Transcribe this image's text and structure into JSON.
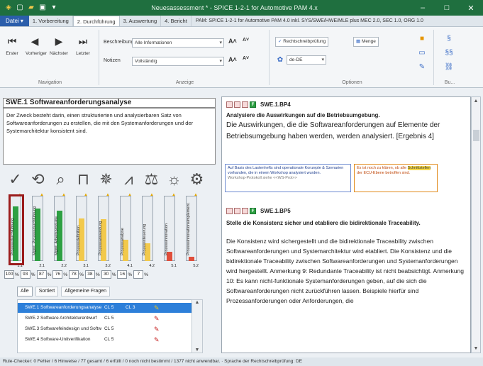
{
  "window": {
    "title": "Neuesassessment * - SPICE 1-2-1 for Automotive PAM 4.x",
    "minimize": "–",
    "maximize": "□",
    "close": "✕"
  },
  "tabs": {
    "file": "Datei ▾",
    "items": [
      "1. Vorbereitung",
      "2. Durchführung",
      "3. Auswertung",
      "4. Bericht"
    ],
    "active_index": 1,
    "info": "PAM: SPICE 1-2-1 for Automotive PAM 4.0 inkl. SYS/SWE/HWE/MLE plus MEC 2.0, SEC 1.0, ORG 1.0"
  },
  "ribbon": {
    "nav": {
      "first": "Erster",
      "prev": "Vorheriger",
      "next": "Nächster",
      "last": "Letzter",
      "group_label": "Navigation"
    },
    "display": {
      "desc_label": "Beschreibung",
      "desc_value": "Alle Informationen",
      "notes_label": "Notizen",
      "notes_value": "Vollständig",
      "group_label": "Anzeige"
    },
    "options": {
      "spellcheck": "Rechtschreibprüfung",
      "amount": "Menge",
      "language": "de-DE",
      "group_label": "Optionen"
    },
    "more_label": "Bu..."
  },
  "process": {
    "title": "SWE.1 Softwareanforderungsanalyse",
    "description": "Der Zweck besteht darin, einen strukturierten und analysierbaren Satz von Softwareanforderungen zu erstellen, die mit den Systemanforderungen und der Systemarchitektur konsistent sind."
  },
  "attribute_icons": [
    "check-icon",
    "process-icon",
    "search-icon",
    "book-icon",
    "gear-icon",
    "chart-icon",
    "balance-icon",
    "bulb-icon",
    "cogs-icon"
  ],
  "bars": [
    {
      "label": "Prozessdurchführung",
      "level": "1.1",
      "fill": 0.92,
      "color": "#2ea043"
    },
    {
      "label": "Mgmt. Prozessdurchführung",
      "level": "2.1",
      "fill": 0.88,
      "color": "#2ea043"
    },
    {
      "label": "Mgmt. Arbeitsprodukte",
      "level": "2.2",
      "fill": 0.85,
      "color": "#2ea043"
    },
    {
      "label": "Prozessdefinition",
      "level": "3.1",
      "fill": 0.72,
      "color": "#f2c94c"
    },
    {
      "label": "Prozessanwendung",
      "level": "3.2",
      "fill": 0.7,
      "color": "#f2c94c"
    },
    {
      "label": "Prozessanalyse",
      "level": "4.1",
      "fill": 0.36,
      "color": "#f2c94c"
    },
    {
      "label": "Prozesssteuerung",
      "level": "4.2",
      "fill": 0.3,
      "color": "#f2c94c"
    },
    {
      "label": "Prozessinnovation",
      "level": "5.1",
      "fill": 0.16,
      "color": "#e04e3b"
    },
    {
      "label": "Prozessinnovationsimplement.",
      "level": "5.2",
      "fill": 0.07,
      "color": "#e04e3b"
    }
  ],
  "percents": [
    "100",
    "93",
    "87",
    "76",
    "78",
    "38",
    "30",
    "16",
    "7"
  ],
  "percent_sign": "%",
  "filters": [
    "Alle",
    "Sortiert",
    "Allgemeine Fragen"
  ],
  "process_list": [
    {
      "name": "SWE.1 Softwareanforderungsanalyse",
      "cl1": "CL 5",
      "cl2": "CL 3",
      "selected": true
    },
    {
      "name": "SWE.2 Software Architekturentwurf",
      "cl1": "CL 5",
      "cl2": "",
      "selected": false
    },
    {
      "name": "SWE.3 Softwarefeindesign und Softw",
      "cl1": "CL 5",
      "cl2": "",
      "selected": false
    },
    {
      "name": "SWE.4 Software-Unitverifikation",
      "cl1": "CL 5",
      "cl2": "",
      "selected": false
    }
  ],
  "practices": {
    "bp4": {
      "id": "SWE.1.BP4",
      "flag": "F",
      "title": "Analysiere die Auswirkungen auf die Betriebsumgebung.",
      "text": "Die Auswirkungen, die die Softwareanforderungen auf Elemente der Betriebsumgebung haben werden, werden analysiert. [Ergebnis 4]",
      "note": "Auf Basis des Lastenhefts sind operationale Konzepte & Szenarien vorhanden, die in einem Workshop analysiert wurden.",
      "note_link": "Workshop-Protokoll siehe <<WS-Prot>>",
      "comment_pre": "Es ist noch zu klären, ob alle ",
      "comment_highlight": "Schnittstellen",
      "comment_post": " der ECU-Ebene betroffen sind."
    },
    "bp5": {
      "id": "SWE.1.BP5",
      "flag": "F",
      "title": "Stelle die Konsistenz sicher und etabliere die bidirektionale Traceability.",
      "text": "Die Konsistenz wird sichergestellt und die bidirektionale Traceability zwischen Softwareanforderungen und Systemarchitektur wird etabliert. Die Konsistenz und die bidirektionale Traceability zwischen Softwareanforderungen und Systemanforderungen wird hergestellt. Anmerkung 9: Redundante Traceability ist nicht beabsichtigt. Anmerkung 10: Es kann nicht-funktionale Systemanforderungen geben, auf die sich die Softwareanforderungen nicht zurückführen lassen. Beispiele hierfür sind Prozessanforderungen oder Anforderungen, die"
    }
  },
  "status": "Rule-Checker: 0 Fehler / 6 Hinweise / 77 gesamt / 6 erfüllt / 0 noch nicht bestimmt / 1377 nicht anwendbar. · Sprache der Rechtschreibprüfung: DE"
}
